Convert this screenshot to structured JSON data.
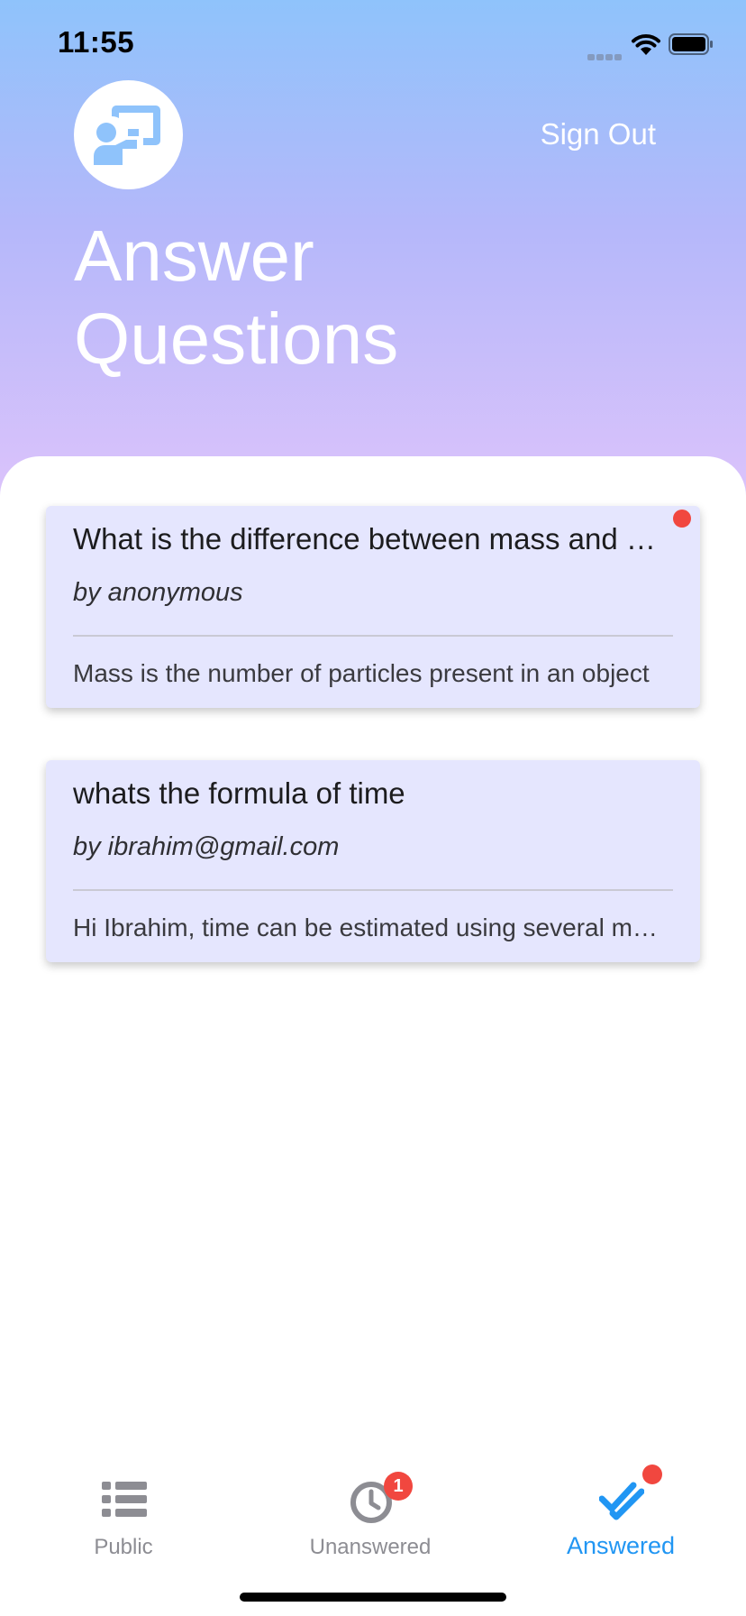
{
  "status_bar": {
    "time": "11:55"
  },
  "header": {
    "avatar_icon": "presenter-board-icon",
    "sign_out_label": "Sign Out",
    "title_lines": [
      "Answer",
      "Questions"
    ]
  },
  "questions": [
    {
      "title": "What is the difference between mass and weight",
      "author": "by anonymous",
      "answer": "Mass is the number of particles present in an object",
      "unread": true
    },
    {
      "title": "whats the formula of time",
      "author": "by ibrahim@gmail.com",
      "answer": "Hi Ibrahim, time can be estimated using several methods",
      "unread": false
    }
  ],
  "tabs": [
    {
      "label": "Public",
      "icon": "list-icon",
      "active": false,
      "badge": ""
    },
    {
      "label": "Unanswered",
      "icon": "clock-icon",
      "active": false,
      "badge": "1"
    },
    {
      "label": "Answered",
      "icon": "double-check-icon",
      "active": true,
      "badge_dot": true
    }
  ],
  "colors": {
    "accent": "#2196f3",
    "badge": "#f1473f",
    "card_background": "#e5e6fe",
    "avatar_icon": "#8fc3fb"
  }
}
